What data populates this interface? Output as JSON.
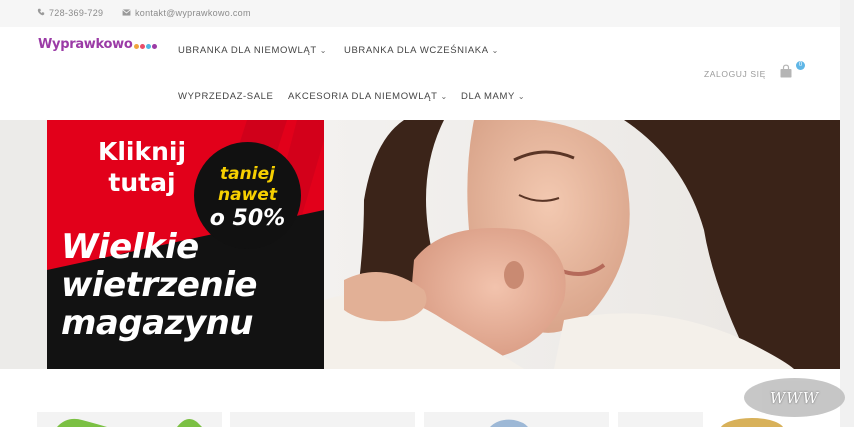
{
  "topbar": {
    "phone": "728-369-729",
    "email": "kontakt@wyprawkowo.com"
  },
  "logo": {
    "text": "Wyprawkowo"
  },
  "nav": [
    {
      "label": "UBRANKA DLA NIEMOWLĄT",
      "has_dropdown": true
    },
    {
      "label": "UBRANKA DLA WCZEŚNIAKA",
      "has_dropdown": true
    },
    {
      "label": "WYPRZEDAZ-SALE",
      "has_dropdown": false
    },
    {
      "label": "AKCESORIA DLA NIEMOWLĄT",
      "has_dropdown": true
    },
    {
      "label": "DLA MAMY",
      "has_dropdown": true
    }
  ],
  "account": {
    "login": "ZALOGUJ SIĘ",
    "cart_count": "0"
  },
  "promo": {
    "line1": "Kliknij",
    "line2": "tutaj",
    "badge_line1": "taniej",
    "badge_line2": "nawet",
    "badge_line3": "o 50%",
    "headline1": "Wielkie",
    "headline2": "wietrzenie",
    "headline3": "magazynu"
  },
  "watermark": "WWW",
  "colors": {
    "brand_purple": "#9b3ba6",
    "promo_red": "#e2001a",
    "badge_yellow": "#f7d000",
    "cart_badge": "#5fb6e6"
  }
}
